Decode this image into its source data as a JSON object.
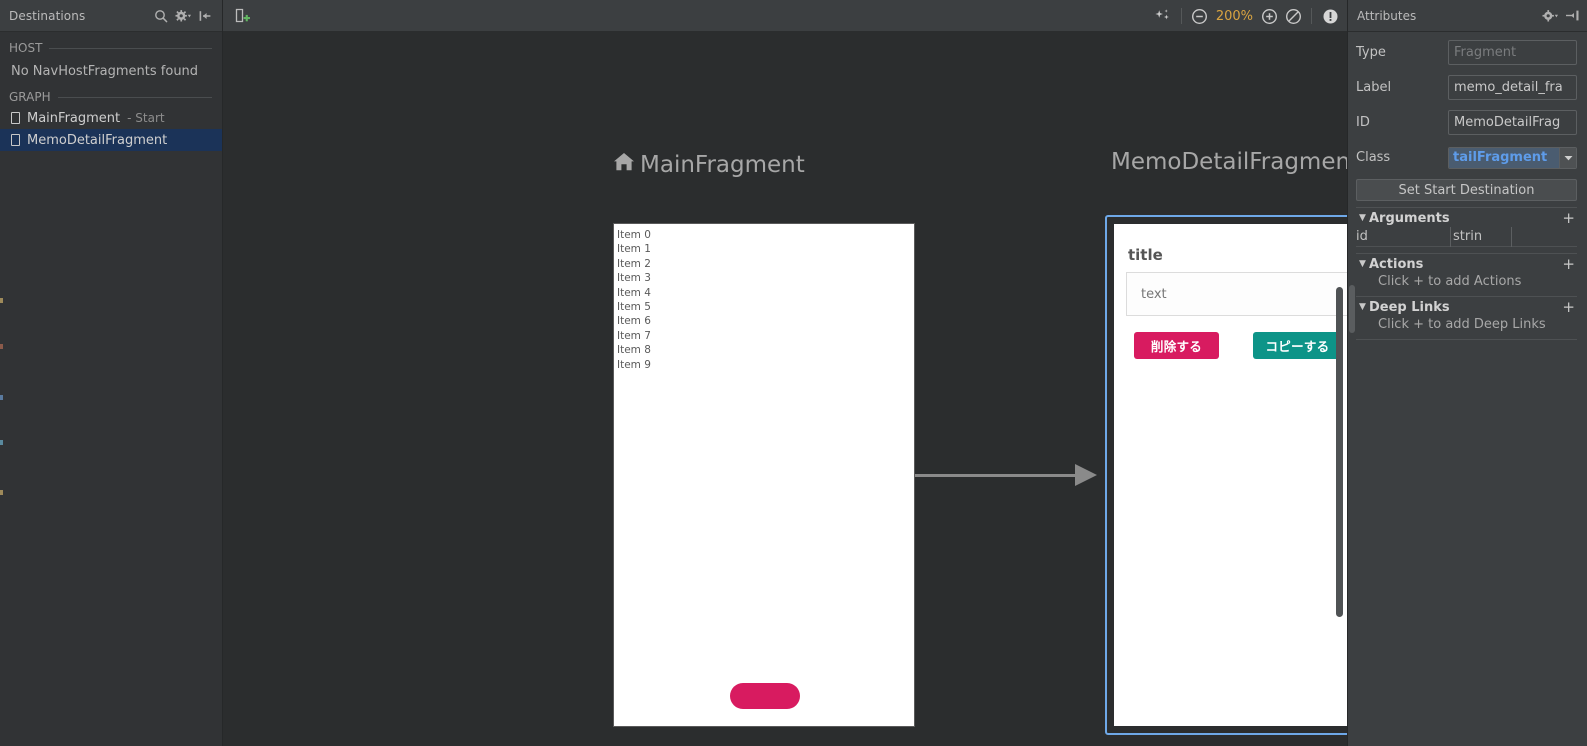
{
  "left_panel": {
    "title": "Destinations",
    "toolbar_icons": [
      "search-icon",
      "gear-dropdown-icon",
      "collapse-all-icon"
    ],
    "sections": [
      {
        "label": "HOST",
        "empty_message": "No NavHostFragments found",
        "items": []
      },
      {
        "label": "GRAPH",
        "empty_message": "",
        "items": [
          {
            "name": "MainFragment",
            "suffix": "- Start",
            "selected": false
          },
          {
            "name": "MemoDetailFragment",
            "suffix": "",
            "selected": true
          }
        ]
      }
    ]
  },
  "center": {
    "toolbar": {
      "new_destination_icon": "new-destination-icon",
      "magic_icon": "auto-arrange-icon",
      "zoom_out_icon": "zoom-out-icon",
      "zoom_level": "200%",
      "zoom_in_icon": "zoom-in-icon",
      "zoom_fit_icon": "zoom-reset-icon",
      "issues_icon": "issues-icon"
    },
    "destinations": [
      {
        "title": "MainFragment",
        "is_start": true,
        "start_icon": "home-icon",
        "selected": false,
        "list_items": [
          "Item 0",
          "Item 1",
          "Item 2",
          "Item 3",
          "Item 4",
          "Item 5",
          "Item 6",
          "Item 7",
          "Item 8",
          "Item 9"
        ],
        "fab_color": "#d81b60"
      },
      {
        "title": "MemoDetailFragment",
        "is_start": false,
        "selected": true,
        "heading": "title",
        "input_text": "text",
        "buttons": [
          {
            "label": "削除する",
            "color": "#d81b60"
          },
          {
            "label": "コピーする",
            "color": "#0d9488"
          }
        ]
      }
    ],
    "connection": {
      "from": "MainFragment",
      "to": "MemoDetailFragment",
      "color": "#8a8a8a"
    }
  },
  "right_panel": {
    "title": "Attributes",
    "toolbar_icons": [
      "gear-dropdown-icon",
      "hide-panel-icon"
    ],
    "fields": [
      {
        "label": "Type",
        "value": "Fragment",
        "kind": "readonly"
      },
      {
        "label": "Label",
        "value": "memo_detail_fra",
        "kind": "text"
      },
      {
        "label": "ID",
        "value": "MemoDetailFrag",
        "kind": "text"
      },
      {
        "label": "Class",
        "value": "tailFragment",
        "kind": "combo"
      }
    ],
    "set_start_button": "Set Start Destination",
    "groups": [
      {
        "name": "Arguments",
        "expanded": true,
        "add_label": "+",
        "rows": [
          {
            "key": "id",
            "value": "strin"
          }
        ],
        "hint": ""
      },
      {
        "name": "Actions",
        "expanded": true,
        "add_label": "+",
        "rows": [],
        "hint": "Click + to add Actions"
      },
      {
        "name": "Deep Links",
        "expanded": true,
        "add_label": "+",
        "rows": [],
        "hint": "Click + to add Deep Links"
      }
    ]
  },
  "colors": {
    "accent_blue": "#6ea8e8",
    "zoom_text": "#d9a441",
    "selection_row": "#1b3358",
    "panel_bg": "#3c3f41",
    "canvas_bg": "#2b2d2e"
  }
}
